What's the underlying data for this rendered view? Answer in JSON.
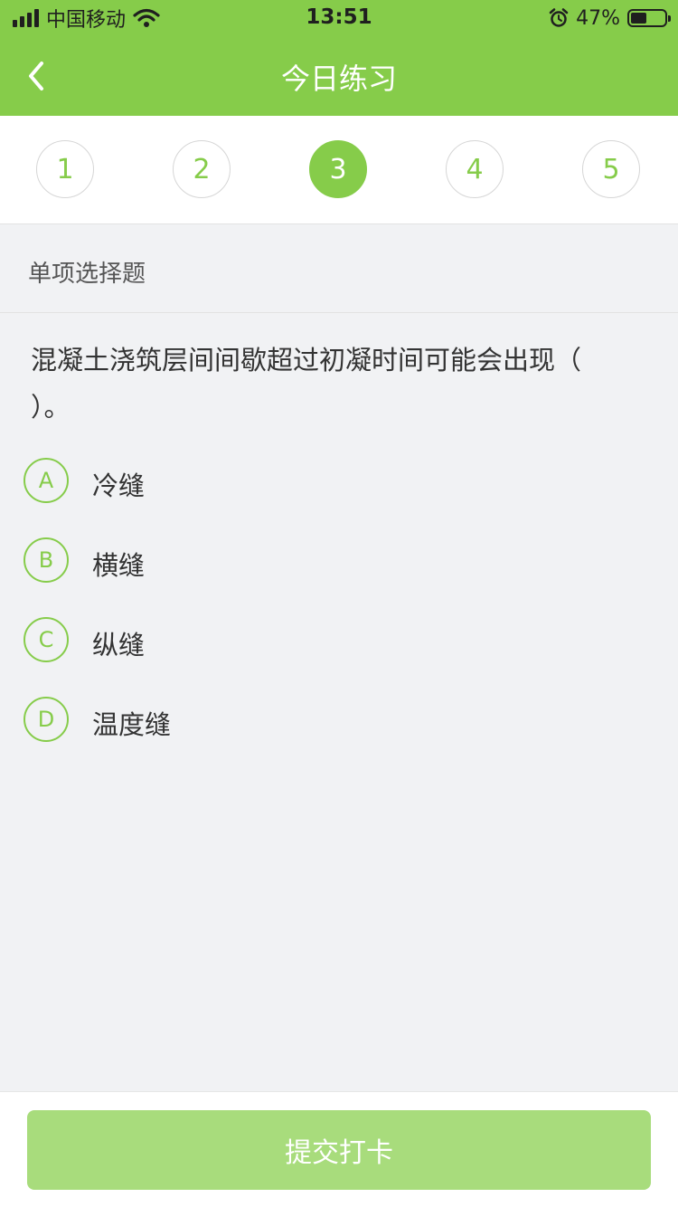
{
  "status_bar": {
    "carrier": "中国移动",
    "time": "13:51",
    "battery_percent_label": "47%",
    "battery_level": 0.47,
    "icons": [
      "signal-icon",
      "wifi-icon",
      "alarm-icon",
      "battery-icon"
    ]
  },
  "header": {
    "title": "今日练习",
    "back_icon": "chevron-left-icon",
    "background": "#86cc4a"
  },
  "steps": {
    "items": [
      "1",
      "2",
      "3",
      "4",
      "5"
    ],
    "active_index": 2
  },
  "question": {
    "type_label": "单项选择题",
    "text": "混凝土浇筑层间间歇超过初凝时间可能会出现（ ）。",
    "options": [
      {
        "letter": "A",
        "text": "冷缝"
      },
      {
        "letter": "B",
        "text": "横缝"
      },
      {
        "letter": "C",
        "text": "纵缝"
      },
      {
        "letter": "D",
        "text": "温度缝"
      }
    ]
  },
  "footer": {
    "submit_label": "提交打卡",
    "submit_color": "#a8dc7c"
  },
  "colors": {
    "accent": "#86cc4a",
    "page_background": "#f1f2f4"
  }
}
